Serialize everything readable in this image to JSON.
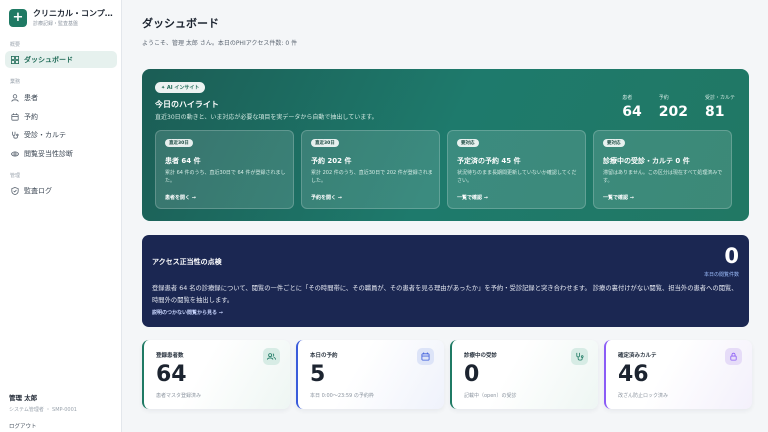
{
  "app": {
    "title": "クリニカル・コンプ…",
    "subtitle": "診療記録・監査基盤"
  },
  "nav": {
    "section_overview": "概要",
    "section_work": "業務",
    "section_admin": "管理",
    "items": [
      {
        "label": "ダッシュボード",
        "icon": "grid-icon"
      },
      {
        "label": "患者",
        "icon": "user-icon"
      },
      {
        "label": "予約",
        "icon": "calendar-icon"
      },
      {
        "label": "受診・カルテ",
        "icon": "stethoscope-icon"
      },
      {
        "label": "閲覧妥当性診断",
        "icon": "eye-icon"
      },
      {
        "label": "監査ログ",
        "icon": "shield-icon"
      }
    ]
  },
  "user": {
    "name": "管理 太郎",
    "role": "システム管理者 ・ SMP-0001",
    "logout": "ログアウト"
  },
  "page": {
    "title": "ダッシュボード",
    "welcome": "ようこそ、管理 太郎 さん。本日のPHIアクセス件数: 0 件"
  },
  "insight": {
    "badge": "✦ AI インサイト",
    "title": "今日のハイライト",
    "desc": "直近30日の動きと、いま対応が必要な項目を実データから自動で抽出しています。",
    "stats": [
      {
        "label": "患者",
        "value": "64"
      },
      {
        "label": "予約",
        "value": "202"
      },
      {
        "label": "受診・カルテ",
        "value": "81"
      }
    ],
    "cards": [
      {
        "badge": "直近30日",
        "title": "患者 64 件",
        "desc": "累計 64 件のうち、直近30日で 64 件が登録されました。",
        "link": "患者を開く →"
      },
      {
        "badge": "直近30日",
        "title": "予約 202 件",
        "desc": "累計 202 件のうち、直近30日で 202 件が登録されました。",
        "link": "予約を開く →"
      },
      {
        "badge": "要対応",
        "title": "予定済の予約 45 件",
        "desc": "状況待ちのまま長期間更新していないか確認してください。",
        "link": "一覧で確認 →"
      },
      {
        "badge": "要対応",
        "title": "診療中の受診・カルテ 0 件",
        "desc": "滞留はありません。この区分は現在すべて処理済みです。",
        "link": "一覧で確認 →"
      }
    ]
  },
  "integrity": {
    "title": "アクセス正当性の点検",
    "count": "0",
    "count_label": "本日の閲覧件数",
    "desc": "登録患者 64 名の診療録について、閲覧の一件ごとに「その時間帯に、その職員が、その患者を見る理由があったか」を予約・受診記録と突き合わせます。 診療の裏付けがない閲覧、担当外の患者への閲覧、時間外の閲覧を抽出します。",
    "link": "説明のつかない閲覧から見る →"
  },
  "kpis": [
    {
      "label": "登録患者数",
      "value": "64",
      "sub": "患者マスタ登録済み",
      "icon": "users-icon",
      "color": "#1f7a64",
      "bg": "#eef6f3",
      "iconbg": "#d7ece5"
    },
    {
      "label": "本日の予約",
      "value": "5",
      "sub": "本日 0:00〜23:59 の予約枠",
      "icon": "calendar-icon",
      "color": "#3b5bdb",
      "bg": "#eff2fb",
      "iconbg": "#dde4f8"
    },
    {
      "label": "診療中の受診",
      "value": "0",
      "sub": "記載中（open）の受診",
      "icon": "stethoscope-icon",
      "color": "#1f7a64",
      "bg": "#eef6f3",
      "iconbg": "#d7ece5"
    },
    {
      "label": "確定済みカルテ",
      "value": "46",
      "sub": "改ざん防止ロック済み",
      "icon": "lock-icon",
      "color": "#8b5cf6",
      "bg": "#f3f0fb",
      "iconbg": "#e6dcf8"
    }
  ]
}
